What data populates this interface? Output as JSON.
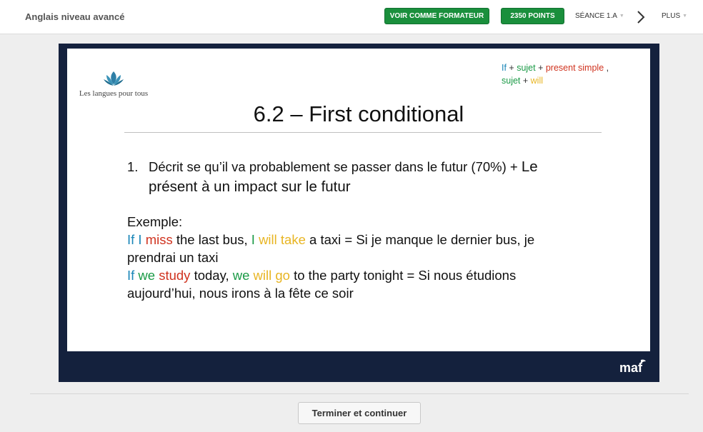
{
  "header": {
    "course_title": "Anglais niveau avancé",
    "trainer_button": "VOIR COMME FORMATEUR",
    "points_button": "2350 POINTS",
    "session_menu": "SÉANCE 1.A",
    "more_menu": "PLUS"
  },
  "slide": {
    "logo_text": "Les langues pour tous",
    "formula": {
      "line1": [
        "If",
        " + ",
        "sujet",
        " + ",
        "present simple",
        " ,"
      ],
      "line2": [
        "sujet",
        " + ",
        "will"
      ]
    },
    "title": "6.2 – First conditional",
    "point": {
      "number": "1.",
      "text_a": "Décrit se qu’il va probablement se passer dans le futur (70%) + ",
      "text_b": "Le",
      "text_c": "présent à un impact sur le futur"
    },
    "example": {
      "label": "Exemple:",
      "ex1": [
        "If",
        " ",
        "I",
        " ",
        "miss",
        " the last bus, ",
        "I",
        " ",
        "will take",
        " a taxi = Si je manque le dernier bus, je prendrai un taxi"
      ],
      "ex2": [
        "If",
        " ",
        "we",
        " ",
        "study",
        " today, ",
        "we",
        " ",
        "will go",
        " to the party tonight = Si nous étudions aujourd’hui, nous irons à la fête ce soir"
      ]
    },
    "brand": "maf"
  },
  "footer": {
    "continue_button": "Terminer et continuer"
  },
  "colors": {
    "accent_green": "#1a8f3c",
    "slide_frame": "#14213d",
    "if_blue": "#1a86b8",
    "verb_red": "#d0331f",
    "subject_green": "#1a9a46",
    "will_yellow": "#e8b523"
  },
  "icons": {
    "next": "chevron-right-icon",
    "menu_caret": "caret-down-icon",
    "logo": "lotus-icon"
  }
}
